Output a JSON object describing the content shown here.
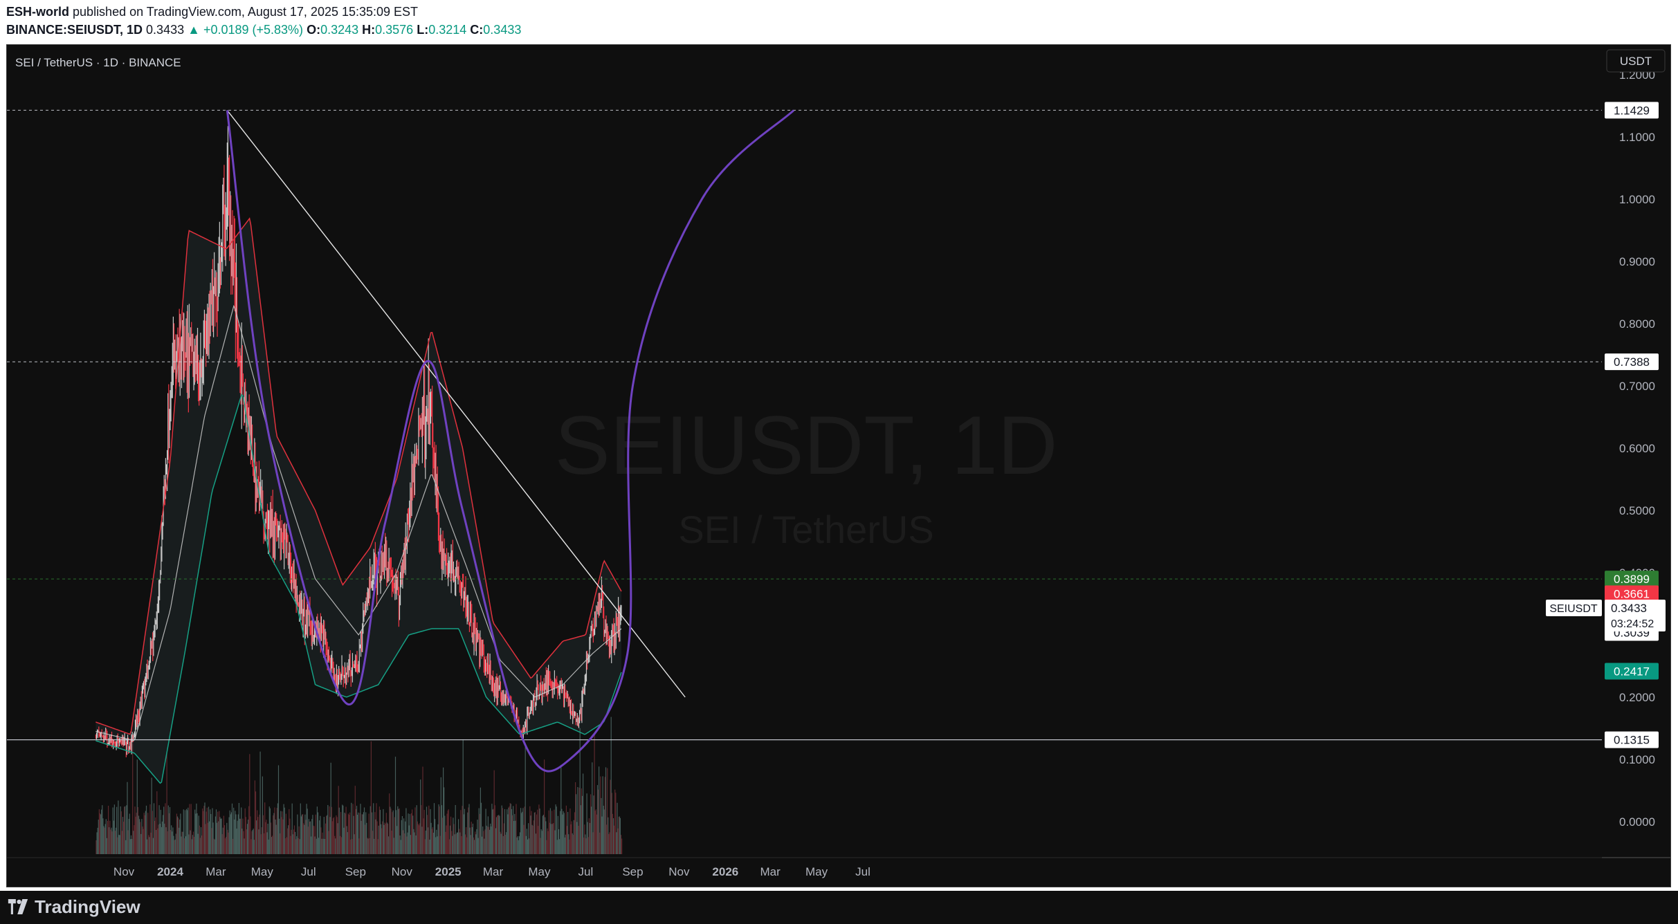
{
  "header": {
    "author": "ESH-world",
    "published_text": "published on TradingView.com, August 17, 2025 15:35:09 EST"
  },
  "ohlc": {
    "symbol_text": "BINANCE:SEIUSDT, 1D",
    "last": "0.3433",
    "change": "▲ +0.0189 (+5.83%)",
    "o_label": "O:",
    "o": "0.3243",
    "h_label": "H:",
    "h": "0.3576",
    "l_label": "L:",
    "l": "0.3214",
    "c_label": "C:",
    "c": "0.3433"
  },
  "legend_title": "SEI / TetherUS · 1D · BINANCE",
  "currency_button": "USDT",
  "watermark": {
    "line1": "SEIUSDT, 1D",
    "line2": "SEI / TetherUS"
  },
  "footer": {
    "brand": "TradingView"
  },
  "colors": {
    "background": "#0f0f0f",
    "up_candle": "#c8c8c8",
    "down_candle": "#f23645",
    "bb_upper": "#e0313d",
    "bb_lower": "#16a085",
    "bb_basis": "#cfcfcf",
    "pattern_curve": "#6f42c1",
    "trendline": "#e8e8e8",
    "badge_green": "#2e7d32",
    "badge_red": "#f23645",
    "badge_teal": "#089981"
  },
  "chart_data": {
    "type": "candlestick",
    "symbol": "SEIUSDT",
    "interval": "1D",
    "y_scale": "linear",
    "ylim": [
      -0.05,
      1.23
    ],
    "x_ticks": [
      "Nov",
      "2024",
      "Mar",
      "May",
      "Jul",
      "Sep",
      "Nov",
      "2025",
      "Mar",
      "May",
      "Jul",
      "Sep",
      "Nov",
      "2026",
      "Mar",
      "May",
      "Jul"
    ],
    "y_ticks": [
      "1.2000",
      "1.1000",
      "1.0000",
      "0.9000",
      "0.8000",
      "0.7000",
      "0.6000",
      "0.5000",
      "0.4000",
      "0.3000",
      "0.2000",
      "0.1000",
      "0.0000"
    ],
    "price_path": [
      {
        "date": "2023-09-25",
        "price": 0.14
      },
      {
        "date": "2023-10-20",
        "price": 0.13
      },
      {
        "date": "2023-11-10",
        "price": 0.12
      },
      {
        "date": "2023-11-25",
        "price": 0.2
      },
      {
        "date": "2023-12-15",
        "price": 0.33
      },
      {
        "date": "2024-01-03",
        "price": 0.74
      },
      {
        "date": "2024-02-10",
        "price": 0.74
      },
      {
        "date": "2024-03-01",
        "price": 0.85
      },
      {
        "date": "2024-03-16",
        "price": 1.03
      },
      {
        "date": "2024-04-05",
        "price": 0.68
      },
      {
        "date": "2024-05-01",
        "price": 0.5
      },
      {
        "date": "2024-06-01",
        "price": 0.44
      },
      {
        "date": "2024-06-25",
        "price": 0.32
      },
      {
        "date": "2024-07-20",
        "price": 0.3
      },
      {
        "date": "2024-08-05",
        "price": 0.22
      },
      {
        "date": "2024-09-05",
        "price": 0.26
      },
      {
        "date": "2024-09-20",
        "price": 0.39
      },
      {
        "date": "2024-10-10",
        "price": 0.43
      },
      {
        "date": "2024-10-28",
        "price": 0.36
      },
      {
        "date": "2024-11-25",
        "price": 0.64
      },
      {
        "date": "2024-12-07",
        "price": 0.68
      },
      {
        "date": "2024-12-22",
        "price": 0.43
      },
      {
        "date": "2025-01-15",
        "price": 0.4
      },
      {
        "date": "2025-02-05",
        "price": 0.3
      },
      {
        "date": "2025-03-01",
        "price": 0.22
      },
      {
        "date": "2025-03-25",
        "price": 0.19
      },
      {
        "date": "2025-04-08",
        "price": 0.14
      },
      {
        "date": "2025-04-25",
        "price": 0.2
      },
      {
        "date": "2025-05-15",
        "price": 0.23
      },
      {
        "date": "2025-06-01",
        "price": 0.21
      },
      {
        "date": "2025-06-22",
        "price": 0.16
      },
      {
        "date": "2025-07-10",
        "price": 0.31
      },
      {
        "date": "2025-07-20",
        "price": 0.36
      },
      {
        "date": "2025-08-02",
        "price": 0.28
      },
      {
        "date": "2025-08-17",
        "price": 0.3433
      }
    ],
    "bollinger_bands": {
      "upper": [
        {
          "date": "2023-09-25",
          "price": 0.16
        },
        {
          "date": "2023-11-10",
          "price": 0.14
        },
        {
          "date": "2024-01-01",
          "price": 0.58
        },
        {
          "date": "2024-01-25",
          "price": 0.95
        },
        {
          "date": "2024-03-15",
          "price": 0.92
        },
        {
          "date": "2024-04-15",
          "price": 0.97
        },
        {
          "date": "2024-05-20",
          "price": 0.62
        },
        {
          "date": "2024-07-10",
          "price": 0.5
        },
        {
          "date": "2024-08-15",
          "price": 0.38
        },
        {
          "date": "2024-09-20",
          "price": 0.44
        },
        {
          "date": "2024-10-25",
          "price": 0.55
        },
        {
          "date": "2024-12-10",
          "price": 0.79
        },
        {
          "date": "2025-01-20",
          "price": 0.6
        },
        {
          "date": "2025-03-01",
          "price": 0.32
        },
        {
          "date": "2025-04-20",
          "price": 0.23
        },
        {
          "date": "2025-06-01",
          "price": 0.29
        },
        {
          "date": "2025-07-01",
          "price": 0.3
        },
        {
          "date": "2025-07-25",
          "price": 0.42
        },
        {
          "date": "2025-08-17",
          "price": 0.37
        }
      ],
      "basis": [
        {
          "date": "2023-09-25",
          "price": 0.145
        },
        {
          "date": "2023-11-15",
          "price": 0.13
        },
        {
          "date": "2024-01-01",
          "price": 0.34
        },
        {
          "date": "2024-02-15",
          "price": 0.65
        },
        {
          "date": "2024-03-25",
          "price": 0.83
        },
        {
          "date": "2024-05-15",
          "price": 0.6
        },
        {
          "date": "2024-07-10",
          "price": 0.39
        },
        {
          "date": "2024-09-05",
          "price": 0.3
        },
        {
          "date": "2024-10-25",
          "price": 0.4
        },
        {
          "date": "2024-12-10",
          "price": 0.56
        },
        {
          "date": "2025-01-25",
          "price": 0.41
        },
        {
          "date": "2025-03-10",
          "price": 0.26
        },
        {
          "date": "2025-04-25",
          "price": 0.2
        },
        {
          "date": "2025-06-01",
          "price": 0.22
        },
        {
          "date": "2025-07-10",
          "price": 0.27
        },
        {
          "date": "2025-08-17",
          "price": 0.31
        }
      ],
      "lower": [
        {
          "date": "2023-09-25",
          "price": 0.13
        },
        {
          "date": "2023-11-15",
          "price": 0.11
        },
        {
          "date": "2023-12-20",
          "price": 0.06
        },
        {
          "date": "2024-01-20",
          "price": 0.27
        },
        {
          "date": "2024-02-25",
          "price": 0.53
        },
        {
          "date": "2024-04-05",
          "price": 0.69
        },
        {
          "date": "2024-05-10",
          "price": 0.43
        },
        {
          "date": "2024-06-15",
          "price": 0.35
        },
        {
          "date": "2024-07-10",
          "price": 0.22
        },
        {
          "date": "2024-08-20",
          "price": 0.2
        },
        {
          "date": "2024-10-01",
          "price": 0.22
        },
        {
          "date": "2024-11-10",
          "price": 0.3
        },
        {
          "date": "2024-12-10",
          "price": 0.31
        },
        {
          "date": "2025-01-15",
          "price": 0.31
        },
        {
          "date": "2025-02-20",
          "price": 0.2
        },
        {
          "date": "2025-04-05",
          "price": 0.14
        },
        {
          "date": "2025-05-25",
          "price": 0.16
        },
        {
          "date": "2025-06-30",
          "price": 0.14
        },
        {
          "date": "2025-07-25",
          "price": 0.16
        },
        {
          "date": "2025-08-17",
          "price": 0.24
        }
      ]
    },
    "trendline": [
      {
        "date": "2024-03-16",
        "price": 1.1429
      },
      {
        "date": "2025-11-09",
        "price": 0.2
      }
    ],
    "pattern_curve": [
      {
        "date": "2024-03-16",
        "price": 1.1429
      },
      {
        "date": "2024-05-10",
        "price": 0.62
      },
      {
        "date": "2024-08-20",
        "price": 0.19
      },
      {
        "date": "2024-10-10",
        "price": 0.48
      },
      {
        "date": "2024-12-05",
        "price": 0.74
      },
      {
        "date": "2025-01-20",
        "price": 0.5
      },
      {
        "date": "2025-04-10",
        "price": 0.13
      },
      {
        "date": "2025-06-10",
        "price": 0.1
      },
      {
        "date": "2025-08-25",
        "price": 0.27
      },
      {
        "date": "2025-09-01",
        "price": 0.7
      },
      {
        "date": "2025-12-01",
        "price": 1.0
      },
      {
        "date": "2026-04-01",
        "price": 1.1429
      }
    ],
    "horizontal_levels": [
      {
        "price": 1.1429,
        "label": "1.1429",
        "style": "dashed"
      },
      {
        "price": 0.7388,
        "label": "0.7388",
        "style": "dashed"
      },
      {
        "price": 0.3899,
        "label": "0.3899",
        "style": "dashed"
      },
      {
        "price": 0.1315,
        "label": "0.1315",
        "style": "solid"
      }
    ],
    "price_badges": [
      {
        "price": 1.1429,
        "label": "1.1429",
        "color": "#ffffff",
        "text_color": "#131722"
      },
      {
        "price": 0.7388,
        "label": "0.7388",
        "color": "#ffffff",
        "text_color": "#131722"
      },
      {
        "price": 0.3899,
        "label": "0.3899",
        "color": "#2e7d32",
        "text_color": "#ffffff"
      },
      {
        "price": 0.3661,
        "label": "0.3661",
        "color": "#f23645",
        "text_color": "#ffffff"
      },
      {
        "price": 0.3039,
        "label": "0.3039",
        "color": "#ffffff",
        "text_color": "#131722"
      },
      {
        "price": 0.2417,
        "label": "0.2417",
        "color": "#089981",
        "text_color": "#ffffff"
      },
      {
        "price": 0.1315,
        "label": "0.1315",
        "color": "#ffffff",
        "text_color": "#131722"
      }
    ],
    "last_price": {
      "symbol": "SEIUSDT",
      "price": "0.3433",
      "countdown": "03:24:52"
    },
    "volume_histogram": true,
    "grid": false
  }
}
